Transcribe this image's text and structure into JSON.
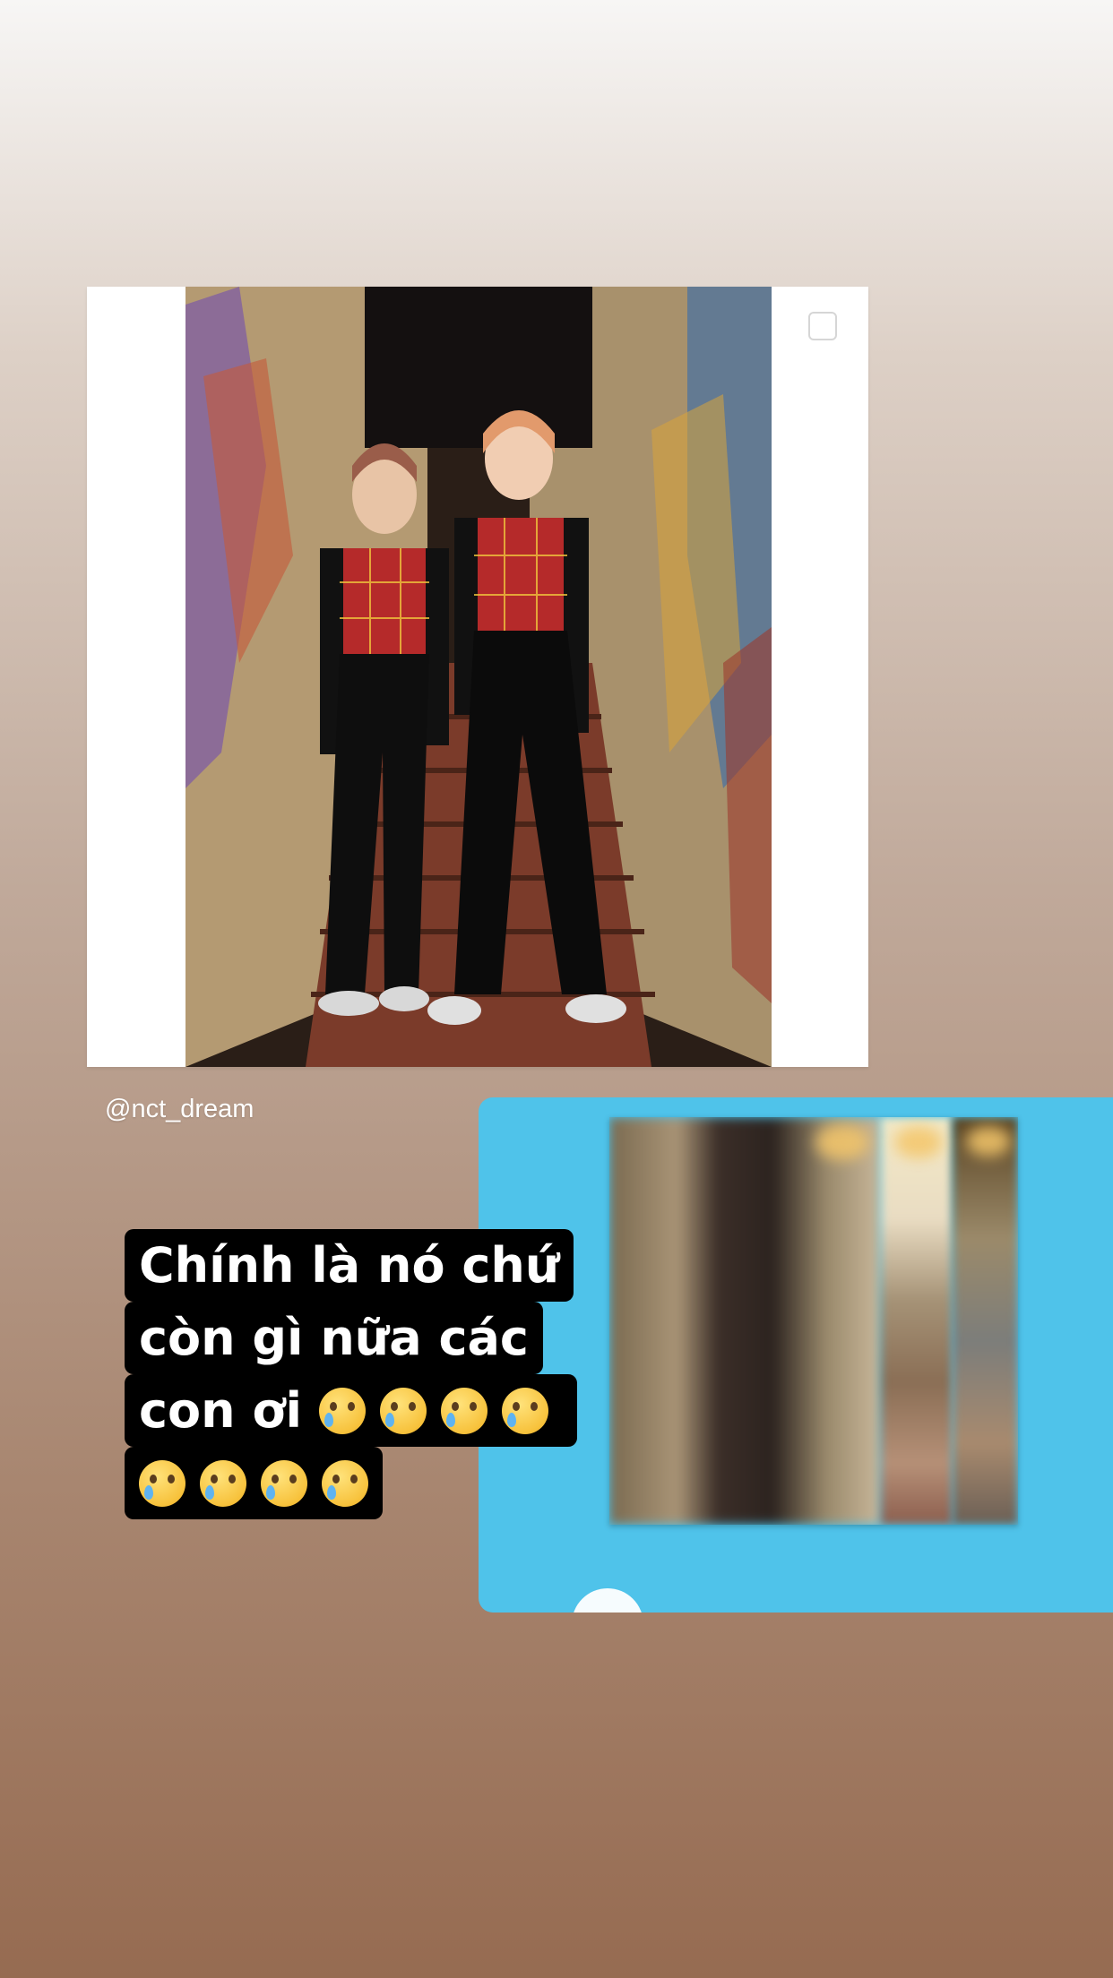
{
  "post": {
    "username": "@nct_dream",
    "photo_alt": "photo"
  },
  "caption": {
    "line1": "Chính là nó chứ",
    "line2": "còn gì nữa các",
    "line3_text": "con ơi",
    "emoji_name": "face-holding-back-tears-icon",
    "line3_emoji_count": 4,
    "line4_emoji_count": 4
  },
  "shared_panel": {
    "background_color": "#4fc3ea"
  }
}
